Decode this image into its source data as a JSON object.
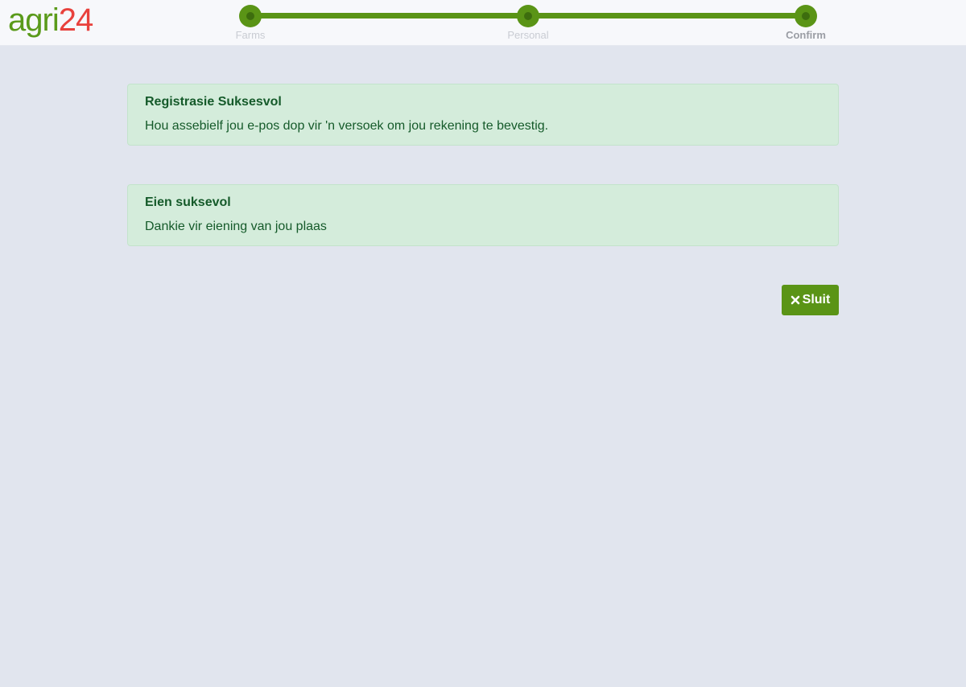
{
  "logo": {
    "part1": "agri",
    "part2": "24"
  },
  "stepper": {
    "steps": [
      {
        "label": "Farms",
        "state": "completed"
      },
      {
        "label": "Personal",
        "state": "completed"
      },
      {
        "label": "Confirm",
        "state": "current"
      }
    ]
  },
  "alerts": [
    {
      "title": "Registrasie Suksesvol",
      "body": "Hou assebielf jou e-pos dop vir 'n versoek om jou rekening te bevestig."
    },
    {
      "title": "Eien suksevol",
      "body": "Dankie vir eiening van jou plaas"
    }
  ],
  "close_button": {
    "label": "Sluit",
    "icon": "close-icon"
  },
  "colors": {
    "brand_green": "#5a9416",
    "brand_red": "#e8413c",
    "success_bg": "#d4ecdb",
    "success_text": "#155a2a",
    "page_bg": "#e1e5ee"
  }
}
